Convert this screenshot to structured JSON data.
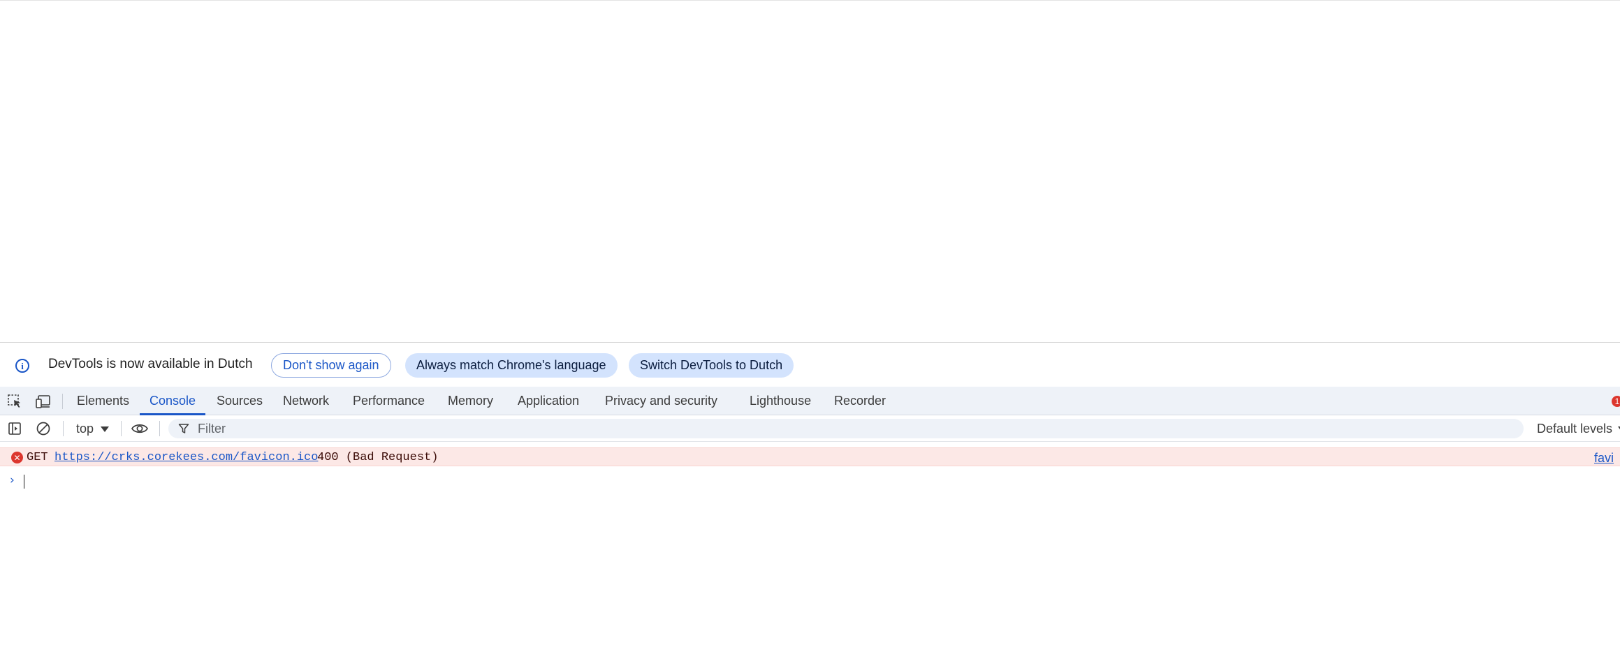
{
  "infobar": {
    "message": "DevTools is now available in Dutch",
    "dont_show_label": "Don't show again",
    "match_language_label": "Always match Chrome's language",
    "switch_label": "Switch DevTools to Dutch"
  },
  "tabs": [
    {
      "label": "Elements"
    },
    {
      "label": "Console"
    },
    {
      "label": "Sources"
    },
    {
      "label": "Network"
    },
    {
      "label": "Performance"
    },
    {
      "label": "Memory"
    },
    {
      "label": "Application"
    },
    {
      "label": "Privacy and security"
    },
    {
      "label": "Lighthouse"
    },
    {
      "label": "Recorder"
    }
  ],
  "active_tab": "Console",
  "error_badge_count": "1",
  "console_toolbar": {
    "context": "top",
    "filter_placeholder": "Filter",
    "levels_label": "Default levels"
  },
  "messages": [
    {
      "level": "error",
      "method": "GET",
      "url": "https://crks.corekees.com/favicon.ico",
      "status": "400 (Bad Request)",
      "source": "favi"
    }
  ],
  "prompt_symbol": "›",
  "colors": {
    "accent": "#1a56c7",
    "error": "#dc362e",
    "error_bg": "#fce8e6",
    "toolbar_bg": "#eef2f8"
  }
}
